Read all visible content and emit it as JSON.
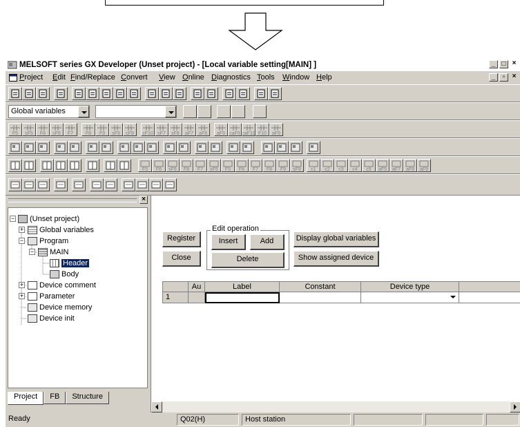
{
  "window": {
    "title": "MELSOFT series GX Developer (Unset project) - [Local variable setting[MAIN]  ]"
  },
  "menu": {
    "items": [
      "Project",
      "Edit",
      "Find/Replace",
      "Convert",
      "View",
      "Online",
      "Diagnostics",
      "Tools",
      "Window",
      "Help"
    ]
  },
  "toolbar": {
    "variables_combo_value": "Global variables",
    "second_combo_value": ""
  },
  "f_keys_row": [
    "F5",
    "sF5",
    "F6",
    "sF6",
    "F7",
    "F8",
    "F9",
    "sF9",
    "cF9",
    "cF10",
    "sF7",
    "sF8",
    "aF7",
    "aF8",
    "aF5",
    "caF5",
    "caF10",
    "F10",
    "aF9"
  ],
  "f_keys_row2": [
    "F5",
    "F6",
    "sF6",
    "F8",
    "F7",
    "sF5",
    "F5",
    "F6",
    "F7",
    "F8",
    "F9",
    "sF9",
    "c1",
    "c2",
    "c3",
    "c4",
    "c5",
    "aF5",
    "aF7",
    "aF8",
    "aF9"
  ],
  "tree": {
    "root": "(Unset project)",
    "global_variables": "Global variables",
    "program": "Program",
    "main": "MAIN",
    "header": "Header",
    "body": "Body",
    "device_comment": "Device comment",
    "parameter": "Parameter",
    "device_memory": "Device memory",
    "device_init": "Device init"
  },
  "tabs": [
    "Project",
    "FB",
    "Structure"
  ],
  "editor": {
    "register_label": "Register",
    "close_label": "Close",
    "edit_operation_label": "Edit operation",
    "insert_label": "Insert",
    "add_label": "Add",
    "delete_label": "Delete",
    "display_global_label": "Display global variables",
    "show_assigned_label": "Show assigned device"
  },
  "grid": {
    "columns": [
      "Au",
      "Label",
      "Constant",
      "Device type"
    ],
    "rows": [
      {
        "num": "1",
        "au": "",
        "label": "",
        "constant": "",
        "device_type": ""
      }
    ]
  },
  "status": {
    "ready": "Ready",
    "cpu": "Q02(H)",
    "station": "Host station"
  }
}
